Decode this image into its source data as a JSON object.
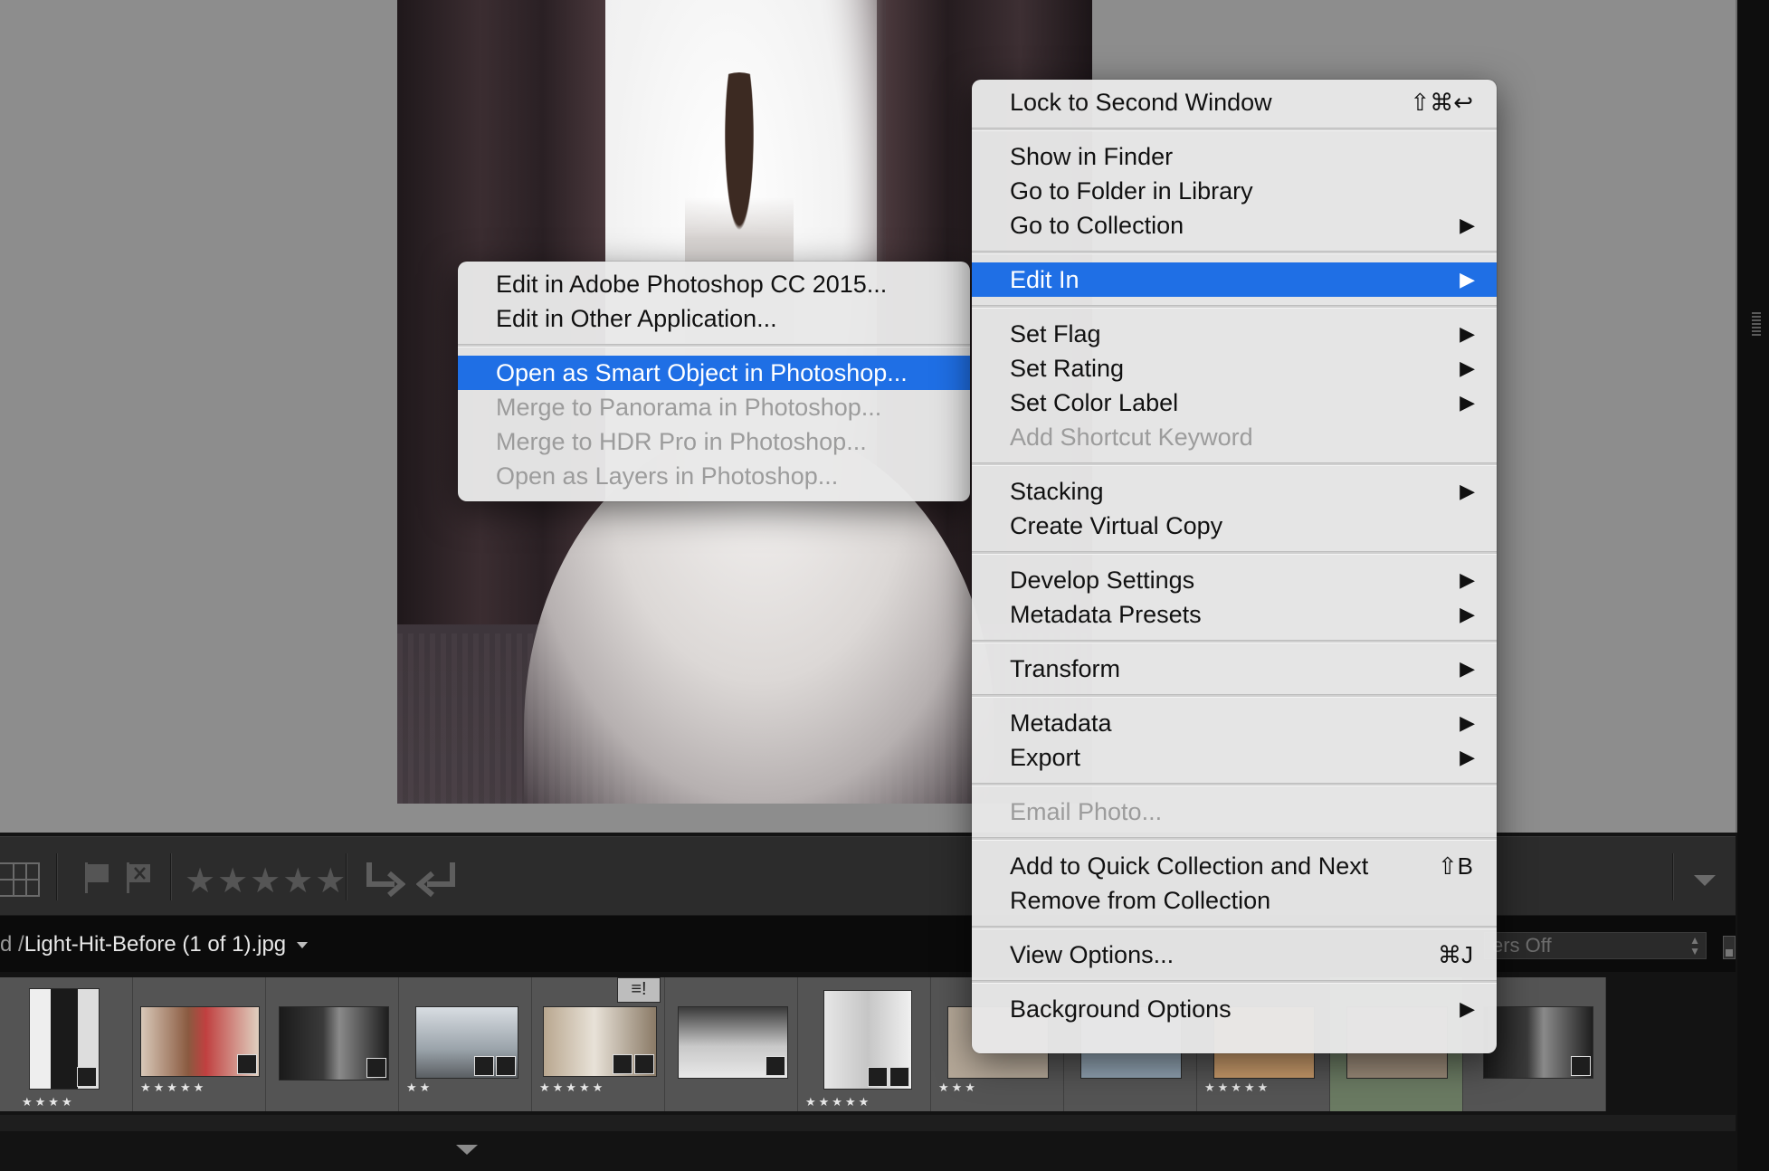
{
  "colors": {
    "highlight": "#1f6fe5",
    "menu_bg": "#e8e8e8",
    "disabled_text": "#9c9c9c"
  },
  "toolbar": {
    "stars_glyph": "★★★★★",
    "rotate_left_glyph": "↳",
    "rotate_right_glyph": "↵",
    "icons": [
      "grid-view-icon",
      "flag-pick-icon",
      "flag-reject-icon",
      "star-rating-icon",
      "rotate-left-icon",
      "rotate-right-icon",
      "collapse-panel-icon"
    ]
  },
  "filmstrip_header": {
    "path_prefix": "d /",
    "filename": "Light-Hit-Before (1 of 1).jpg",
    "filter_value": "ers Off"
  },
  "filmstrip": {
    "thumbnails": [
      {
        "stars": "★★★★"
      },
      {
        "stars": "★★★★★"
      },
      {
        "stars": ""
      },
      {
        "stars": "★★"
      },
      {
        "stars": "★★★★★"
      },
      {
        "stars": ""
      },
      {
        "stars": "★★★★★"
      },
      {
        "stars": "★★★"
      },
      {
        "stars": ""
      },
      {
        "stars": "★★★★★"
      },
      {
        "stars": ""
      },
      {
        "stars": ""
      }
    ]
  },
  "context_menu": {
    "lock": {
      "label": "Lock to Second Window",
      "shortcut": "⇧⌘↩"
    },
    "show_in_finder": "Show in Finder",
    "go_to_folder": "Go to Folder in Library",
    "go_to_collection": "Go to Collection",
    "edit_in": "Edit In",
    "set_flag": "Set Flag",
    "set_rating": "Set Rating",
    "set_color_label": "Set Color Label",
    "add_shortcut_keyword": "Add Shortcut Keyword",
    "stacking": "Stacking",
    "create_virtual_copy": "Create Virtual Copy",
    "develop_settings": "Develop Settings",
    "metadata_presets": "Metadata Presets",
    "transform": "Transform",
    "metadata": "Metadata",
    "export": "Export",
    "email_photo": "Email Photo...",
    "add_quick_collection": {
      "label": "Add to Quick Collection and Next",
      "shortcut": "⇧B"
    },
    "remove_from_collection": "Remove from Collection",
    "view_options": {
      "label": "View Options...",
      "shortcut": "⌘J"
    },
    "background_options": "Background Options",
    "submenu_arrow": "▶"
  },
  "edit_in_submenu": {
    "edit_photoshop": "Edit in Adobe Photoshop CC 2015...",
    "edit_other": "Edit in Other Application...",
    "open_smart_object": "Open as Smart Object in Photoshop...",
    "merge_panorama": "Merge to Panorama in Photoshop...",
    "merge_hdr": "Merge to HDR Pro in Photoshop...",
    "open_layers": "Open as Layers in Photoshop..."
  }
}
